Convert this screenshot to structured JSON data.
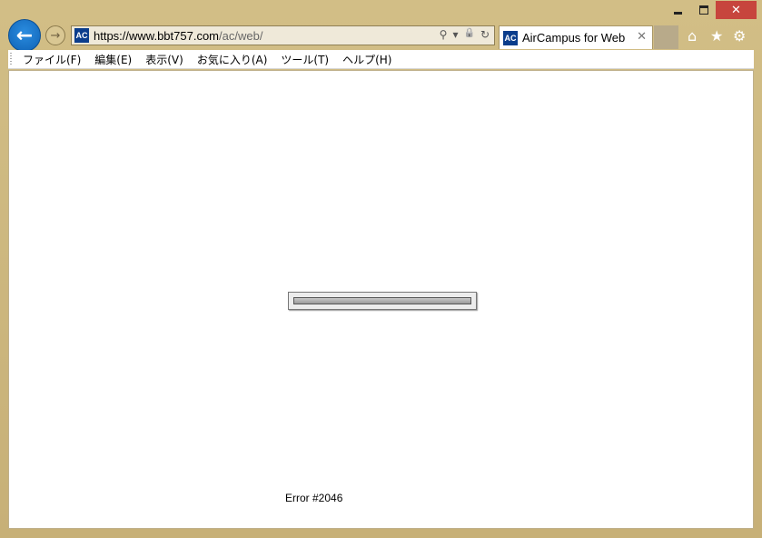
{
  "window": {
    "minimize_icon": "minimize-icon",
    "maximize_icon": "maximize-icon",
    "close_glyph": "✕",
    "close_color": "#c7453d"
  },
  "nav": {
    "back_glyph": "←",
    "forward_glyph": "→",
    "back_color": "#1a74cc"
  },
  "address": {
    "favicon_text": "AC",
    "url_main": "https://www.bbt757.com",
    "url_path": "/ac/web/",
    "search_glyph": "⚲",
    "dropdown_glyph": "▾",
    "lock_glyph": "🔒",
    "refresh_glyph": "↻"
  },
  "tab": {
    "favicon_text": "AC",
    "label": "AirCampus for Web",
    "close_glyph": "✕"
  },
  "toolbar_right": {
    "home_glyph": "⌂",
    "favorites_glyph": "★",
    "settings_glyph": "⚙"
  },
  "menu": {
    "items": [
      "ファイル(F)",
      "編集(E)",
      "表示(V)",
      "お気に入り(A)",
      "ツール(T)",
      "ヘルプ(H)"
    ]
  },
  "content": {
    "progress_fraction": 1.0,
    "error_text": "Error #2046"
  }
}
